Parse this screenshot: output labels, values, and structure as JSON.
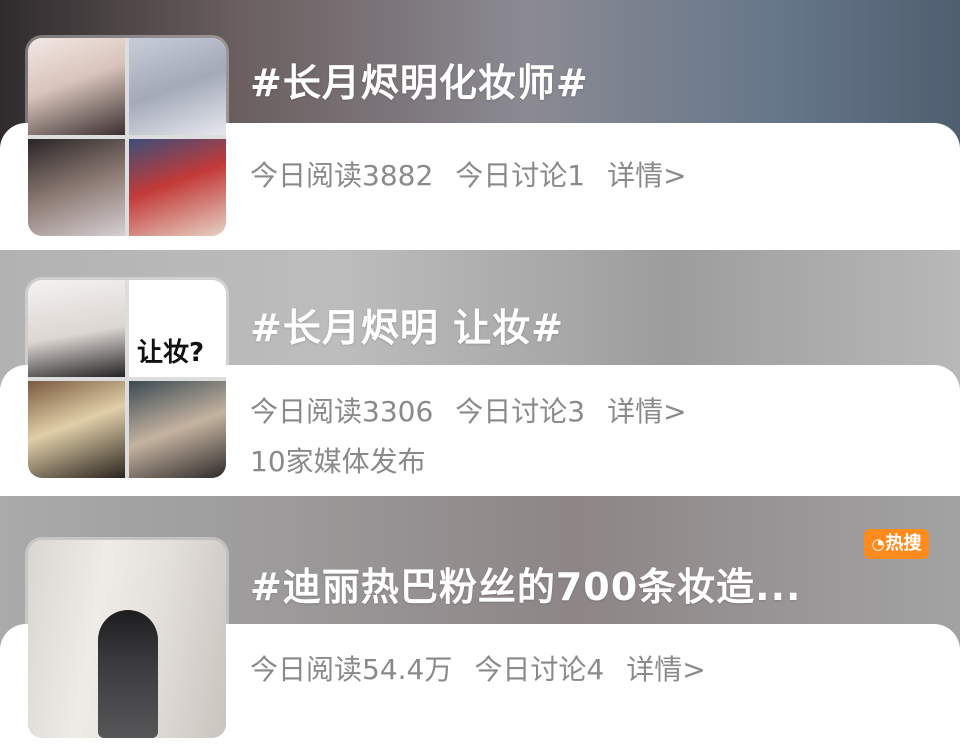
{
  "topics": [
    {
      "title": "#长月烬明化妆师#",
      "read": "今日阅读3882",
      "discuss": "今日讨论1",
      "detail": "详情>"
    },
    {
      "title": "#长月烬明 让妆#",
      "read": "今日阅读3306",
      "discuss": "今日讨论3",
      "detail": "详情>",
      "media": "10家媒体发布",
      "thumb_text": "让妆?"
    },
    {
      "title": "#迪丽热巴粉丝的700条妆造...",
      "read": "今日阅读54.4万",
      "discuss": "今日讨论4",
      "detail": "详情>",
      "badge": "热搜"
    }
  ],
  "colors": {
    "stat_text": "#8a8a8a",
    "badge": "#ff8b1f",
    "title": "#ffffff"
  },
  "icons": {
    "badge_icon": "hot-search-icon"
  }
}
